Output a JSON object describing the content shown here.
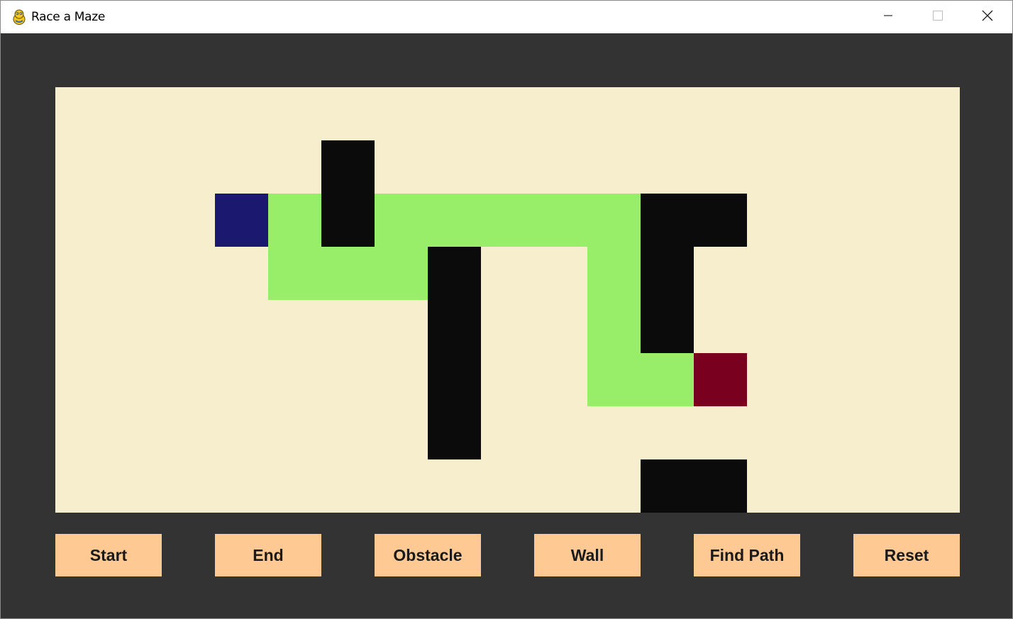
{
  "window": {
    "title": "Race a Maze",
    "app_icon": "pygame-snake-icon",
    "controls": [
      "minimize-icon",
      "maximize-icon",
      "close-icon"
    ]
  },
  "grid": {
    "columns": 17,
    "rows": 8,
    "start": [
      3,
      2
    ],
    "end": [
      12,
      5
    ],
    "walls": [
      [
        5,
        1
      ],
      [
        5,
        2
      ],
      [
        11,
        2
      ],
      [
        12,
        2
      ],
      [
        11,
        3
      ],
      [
        11,
        4
      ],
      [
        7,
        3
      ],
      [
        7,
        4
      ],
      [
        7,
        5
      ],
      [
        7,
        6
      ],
      [
        11,
        7
      ],
      [
        12,
        7
      ]
    ],
    "path": [
      [
        4,
        2
      ],
      [
        4,
        3
      ],
      [
        5,
        3
      ],
      [
        6,
        2
      ],
      [
        6,
        3
      ],
      [
        7,
        2
      ],
      [
        8,
        2
      ],
      [
        9,
        2
      ],
      [
        10,
        2
      ],
      [
        10,
        3
      ],
      [
        10,
        4
      ],
      [
        10,
        5
      ],
      [
        11,
        5
      ]
    ]
  },
  "toolbar": {
    "start_label": "Start",
    "end_label": "End",
    "obstacle_label": "Obstacle",
    "wall_label": "Wall",
    "find_path_label": "Find Path",
    "reset_label": "Reset"
  },
  "colors": {
    "background": "#333333",
    "board": "#f6eecc",
    "wall": "#0b0b0b",
    "path": "#98ee68",
    "start": "#1b1870",
    "end": "#7a0020",
    "button": "#ffc994"
  }
}
